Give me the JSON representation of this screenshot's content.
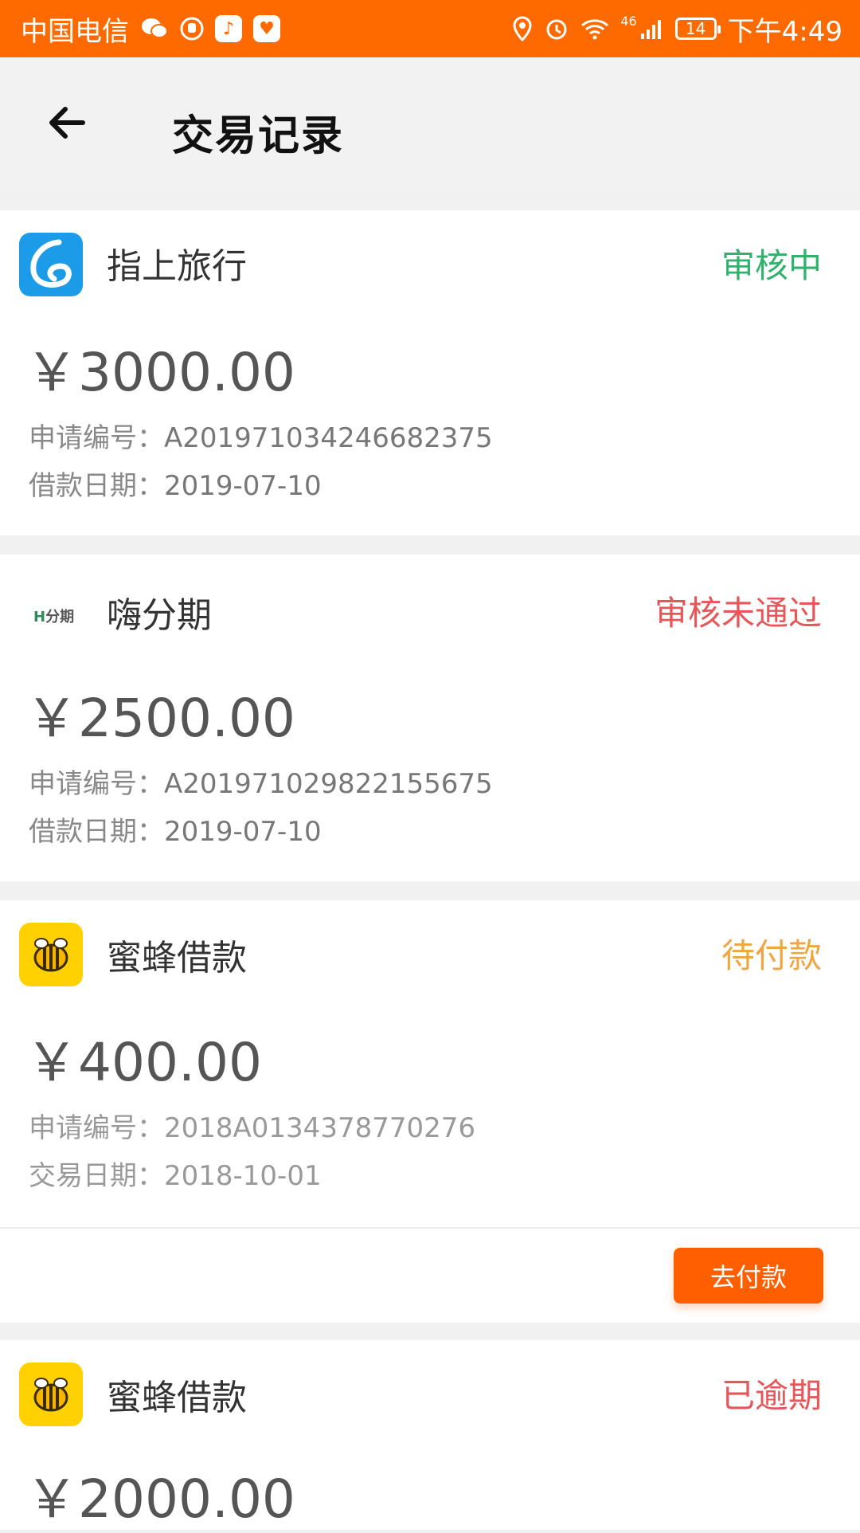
{
  "status_bar": {
    "carrier": "中国电信",
    "network": "46",
    "battery": "14",
    "time": "下午4:49"
  },
  "header": {
    "title": "交易记录"
  },
  "records": [
    {
      "name": "指上旅行",
      "status": "审核中",
      "status_color": "#2fb36c",
      "amount": "￥3000.00",
      "line1_label": "申请编号：",
      "line1_value": "A201971034246682375",
      "line2_label": "借款日期：",
      "line2_value": "2019-07-10",
      "logo": "zhishang-logo"
    },
    {
      "name": "嗨分期",
      "status": "审核未通过",
      "status_color": "#e8565a",
      "amount": "￥2500.00",
      "line1_label": "申请编号：",
      "line1_value": "A201971029822155675",
      "line2_label": "借款日期：",
      "line2_value": "2019-07-10",
      "logo": "haifenqi-logo",
      "logo_text": "分期"
    },
    {
      "name": "蜜蜂借款",
      "status": "待付款",
      "status_color": "#f0a640",
      "amount": "￥400.00",
      "line1_label": "申请编号：",
      "line1_value": "2018A0134378770276",
      "line2_label": "交易日期：",
      "line2_value": "2018-10-01",
      "logo": "bee-logo",
      "action_label": "去付款"
    },
    {
      "name": "蜜蜂借款",
      "status": "已逾期",
      "status_color": "#e8565a",
      "amount": "￥2000.00",
      "logo": "bee-logo"
    }
  ],
  "colors": {
    "accent": "#ff6a00",
    "button": "#ff5f00"
  }
}
